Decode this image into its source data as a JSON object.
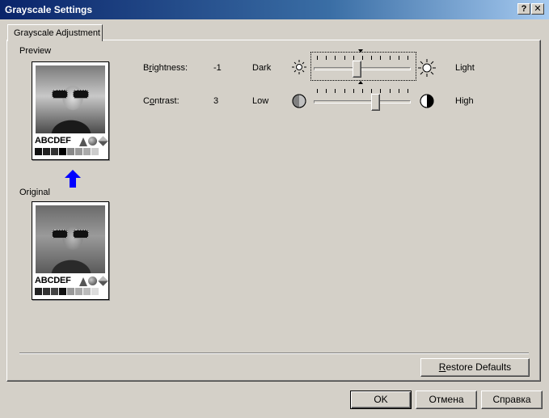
{
  "window": {
    "title": "Grayscale Settings",
    "help_label": "?",
    "close_label": "✕"
  },
  "tab": {
    "label": "Grayscale Adjustment"
  },
  "preview": {
    "label": "Preview",
    "original_label": "Original",
    "sample_text": "ABCDEF",
    "arrow_color": "#0000ff"
  },
  "brightness": {
    "label_pre": "B",
    "label_ul": "r",
    "label_post": "ightness:",
    "value": "-1",
    "min_label": "Dark",
    "max_label": "Light",
    "min_icon": "dim-sun-icon",
    "max_icon": "bright-sun-icon",
    "level": -1,
    "range": [
      -10,
      10
    ]
  },
  "contrast": {
    "label_pre": "C",
    "label_ul": "o",
    "label_post": "ntrast:",
    "value": "3",
    "min_label": "Low",
    "max_label": "High",
    "min_icon": "low-contrast-icon",
    "max_icon": "high-contrast-icon",
    "level": 3,
    "range": [
      -10,
      10
    ]
  },
  "buttons": {
    "restore_ul": "R",
    "restore_post": "estore Defaults",
    "ok": "OK",
    "cancel": "Отмена",
    "help": "Справка"
  },
  "colors": {
    "face": "#d4d0c8",
    "title_start": "#0a246a",
    "title_end": "#a6caf0"
  }
}
